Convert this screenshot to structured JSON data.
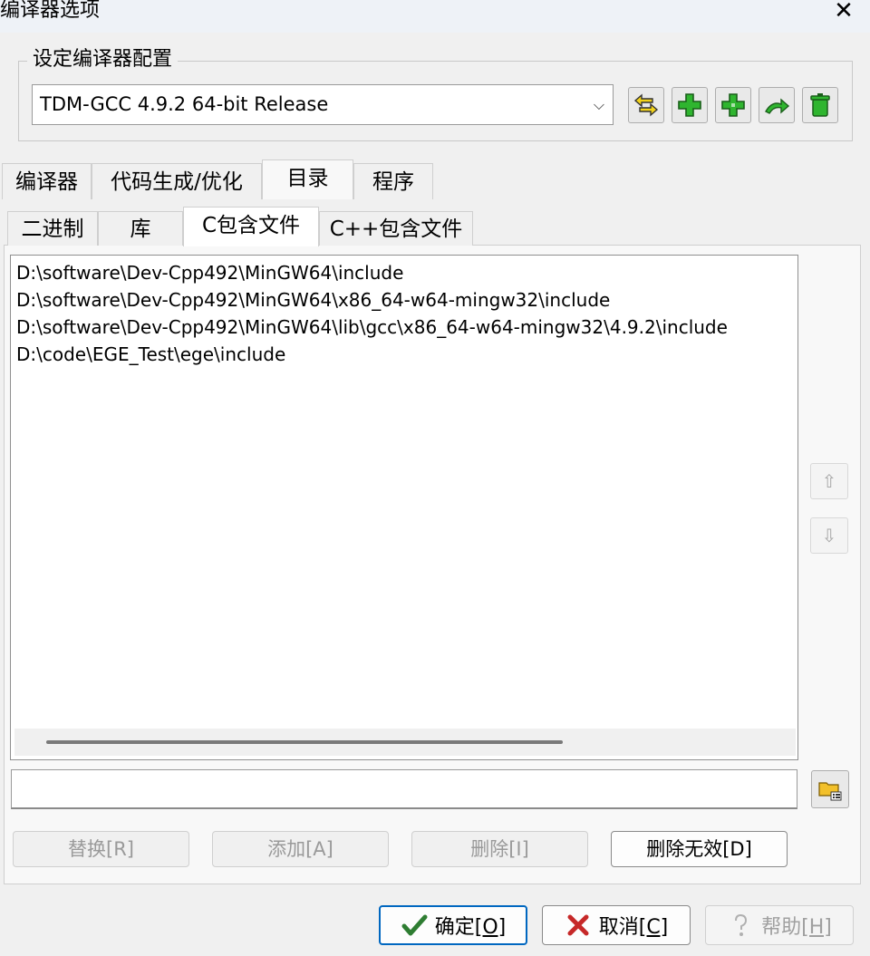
{
  "window": {
    "title": "编译器选项",
    "close_glyph": "✕"
  },
  "config": {
    "group_label": "设定编译器配置",
    "selected": "TDM-GCC 4.9.2 64-bit Release",
    "arrow_glyph": "⌵",
    "toolbar_icons": [
      "swap-icon",
      "add-icon",
      "add-copy-icon",
      "rename-icon",
      "trash-icon"
    ]
  },
  "tabs": [
    "编译器",
    "代码生成/优化",
    "目录",
    "程序"
  ],
  "subtabs": [
    "二进制",
    "库",
    "C包含文件",
    "C++包含文件"
  ],
  "directories": [
    "D:\\software\\Dev-Cpp492\\MinGW64\\include",
    "D:\\software\\Dev-Cpp492\\MinGW64\\x86_64-w64-mingw32\\include",
    "D:\\software\\Dev-Cpp492\\MinGW64\\lib\\gcc\\x86_64-w64-mingw32\\4.9.2\\include",
    "D:\\code\\EGE_Test\\ege\\include"
  ],
  "side": {
    "up_glyph": "⇧",
    "down_glyph": "⇩"
  },
  "path_input": {
    "value": "",
    "placeholder": ""
  },
  "actions": {
    "replace": "替换[R]",
    "add": "添加[A]",
    "delete": "删除[I]",
    "delete_invalid": "删除无效[D]"
  },
  "bottom": {
    "ok_text": "确定",
    "ok_key": "[O]",
    "cancel_text": "取消",
    "cancel_key": "[C]",
    "help_text": "帮助",
    "help_key": "[H]"
  },
  "colors": {
    "accent": "#0067c0",
    "ok_check": "#2e7d32",
    "cancel_x": "#c62828",
    "toolbar_green": "#2fb52f",
    "toolbar_yellow": "#f2d21b"
  }
}
